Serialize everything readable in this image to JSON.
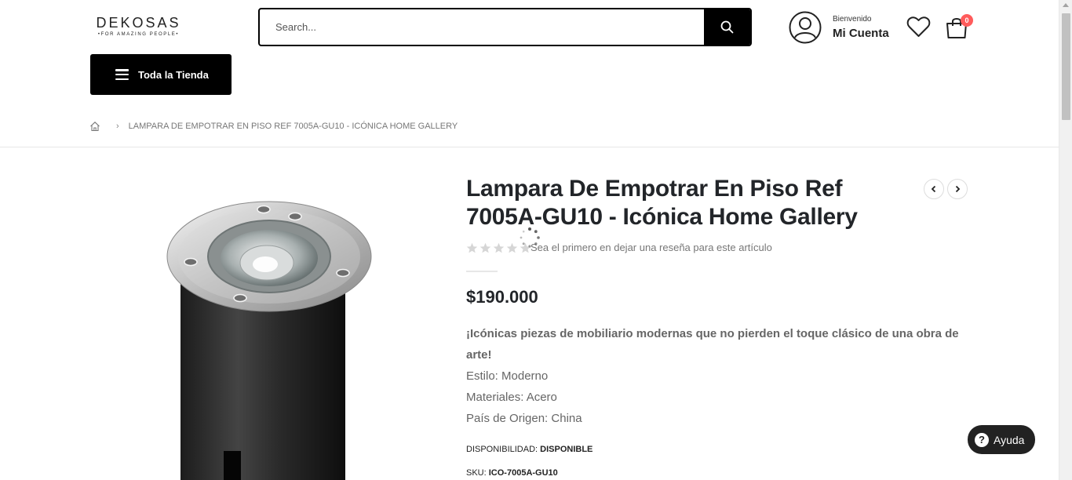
{
  "header": {
    "logo": {
      "main": "DEKOSAS",
      "sub": "•FOR AMAZING PEOPLE•"
    },
    "search": {
      "placeholder": "Search...",
      "value": ""
    },
    "account": {
      "welcome": "Bienvenido",
      "name": "Mi Cuenta"
    },
    "cart_count": "0"
  },
  "nav": {
    "store_button": "Toda la Tienda"
  },
  "breadcrumb": {
    "current": "LAMPARA DE EMPOTRAR EN PISO REF 7005A-GU10 - ICÓNICA HOME GALLERY"
  },
  "product": {
    "title": "Lampara De Empotrar En Piso Ref 7005A-GU10 - Icónica Home Gallery",
    "rating": 0,
    "review_prompt": "Sea el primero en dejar una reseña para este artículo",
    "price": "$190.000",
    "description_lead": "¡Icónicas piezas de mobiliario modernas que no pierden el toque clásico de una obra de arte!",
    "details": [
      "Estilo: Moderno",
      "Materiales: Acero",
      "País de Origen: China"
    ],
    "availability_label": "DISPONIBILIDAD:",
    "availability_value": "DISPONIBLE",
    "sku_label": "SKU:",
    "sku_value": "ICO-7005A-GU10"
  },
  "help": {
    "label": "Ayuda"
  },
  "icons": {
    "search": "search-icon",
    "account": "user-circle-icon",
    "wishlist": "heart-icon",
    "cart": "shopping-bag-icon",
    "home": "home-icon",
    "prev": "chevron-left-icon",
    "next": "chevron-right-icon",
    "help": "question-circle-icon"
  },
  "colors": {
    "accent": "#000000",
    "cart_badge": "#ff5b5b",
    "text": "#222529",
    "muted": "#777777"
  }
}
